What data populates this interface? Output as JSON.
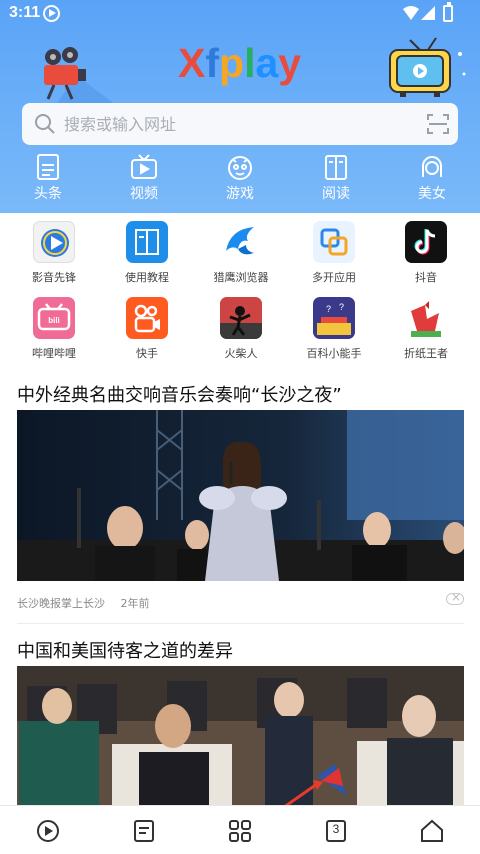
{
  "status_bar": {
    "time": "3:11"
  },
  "header": {
    "logo": {
      "letters": [
        "X",
        "f",
        "p",
        "l",
        "a",
        "y"
      ],
      "colors": [
        "#e94b3c",
        "#2f7bd9",
        "#f5a623",
        "#27ae60",
        "#1e90ff",
        "#e94b3c"
      ]
    },
    "search": {
      "placeholder": "搜索或输入网址"
    },
    "categories": [
      {
        "label": "头条",
        "icon": "news-icon"
      },
      {
        "label": "视频",
        "icon": "video-icon"
      },
      {
        "label": "游戏",
        "icon": "game-icon"
      },
      {
        "label": "阅读",
        "icon": "book-icon"
      },
      {
        "label": "美女",
        "icon": "girl-icon"
      }
    ]
  },
  "apps": [
    {
      "label": "影音先锋",
      "icon": "play-circle-icon"
    },
    {
      "label": "使用教程",
      "icon": "tutorial-book-icon"
    },
    {
      "label": "猎鹰浏览器",
      "icon": "falcon-browser-icon"
    },
    {
      "label": "多开应用",
      "icon": "multi-open-icon"
    },
    {
      "label": "抖音",
      "icon": "tiktok-icon"
    },
    {
      "label": "哔哩哔哩",
      "icon": "bilibili-icon"
    },
    {
      "label": "快手",
      "icon": "kuaishou-icon"
    },
    {
      "label": "火柴人",
      "icon": "stickman-icon"
    },
    {
      "label": "百科小能手",
      "icon": "encyclopedia-icon"
    },
    {
      "label": "折纸王者",
      "icon": "origami-rooster-icon"
    }
  ],
  "news": [
    {
      "title": "中外经典名曲交响音乐会奏响“长沙之夜”",
      "source": "长沙晚报掌上长沙",
      "time": "2年前"
    },
    {
      "title": "中国和美国待客之道的差异"
    }
  ],
  "bottom_nav": [
    {
      "icon": "video-play-icon"
    },
    {
      "icon": "bookmark-list-icon"
    },
    {
      "icon": "grid-menu-icon"
    },
    {
      "icon": "tabs-count-icon",
      "count": "3"
    },
    {
      "icon": "home-icon"
    }
  ],
  "colors": {
    "header": "#5aa3f7",
    "accent_red": "#e8412c"
  }
}
